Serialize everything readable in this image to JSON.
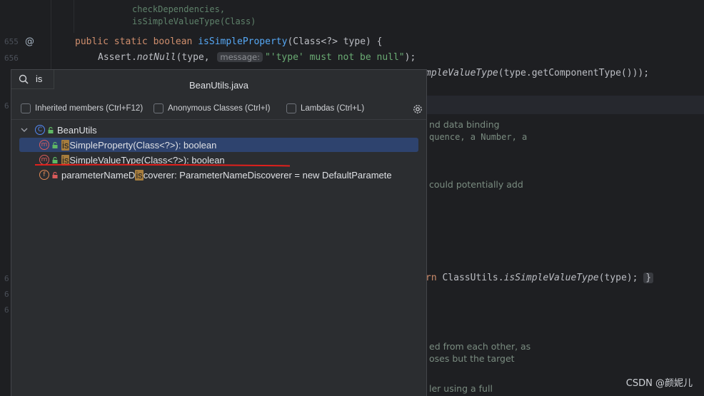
{
  "editor": {
    "line_numbers": [
      "655",
      "656",
      "6",
      "6",
      "6",
      "6"
    ],
    "code": {
      "line_a": "checkDependencies,",
      "line_b": "isSimpleValueType(Class)",
      "sig_kw1": "public",
      "sig_kw2": "static",
      "sig_kw3": "boolean",
      "sig_fn": "isSimpleProperty",
      "sig_rest": "(Class<?> type) {",
      "assert_pre": "Assert.",
      "assert_call": "notNull",
      "assert_args": "(type, ",
      "assert_hint": "message:",
      "assert_str": "\"'type' must not be null\"",
      "assert_end": ");",
      "ret_tail_fn": "mpleValueType",
      "ret_tail_rest": "(type.getComponentType()));",
      "line_n_kw": "rn",
      "line_n_rest": " ClassUtils.",
      "line_n_fn": "isSimpleValueType",
      "line_n_end": "(type);",
      "line_n_fold": "}"
    },
    "javadoc": {
      "t1": "nd data binding",
      "t2": "quence, a Number, a",
      "t3": "could potentially add",
      "t4": "ed from each other, as",
      "t5": "oses but the target",
      "t6": "ler using a full"
    }
  },
  "popup": {
    "search_query": "is",
    "title": "BeanUtils.java",
    "options": [
      {
        "label": "Inherited members (Ctrl+F12)",
        "checked": false
      },
      {
        "label": "Anonymous Classes (Ctrl+I)",
        "checked": false
      },
      {
        "label": "Lambdas (Ctrl+L)",
        "checked": false
      }
    ],
    "tree": {
      "root": "BeanUtils",
      "items": [
        {
          "match": "is",
          "rest": "SimpleProperty(Class<?>): boolean",
          "kind": "method",
          "selected": true
        },
        {
          "match": "is",
          "rest": "SimpleValueType(Class<?>): boolean",
          "kind": "method",
          "selected": false
        },
        {
          "pre": "parameterNameD",
          "match": "is",
          "rest": "coverer: ParameterNameDiscoverer = new DefaultParamete",
          "kind": "field",
          "selected": false
        }
      ]
    }
  },
  "annotation": {
    "underline_color": "#e0201c"
  },
  "watermark": "CSDN @颜妮儿",
  "colors": {
    "selection": "#2e436e",
    "match_highlight": "#a77d3d",
    "method_icon": "#db5c5c",
    "class_icon": "#548af7",
    "field_icon": "#e08855"
  }
}
